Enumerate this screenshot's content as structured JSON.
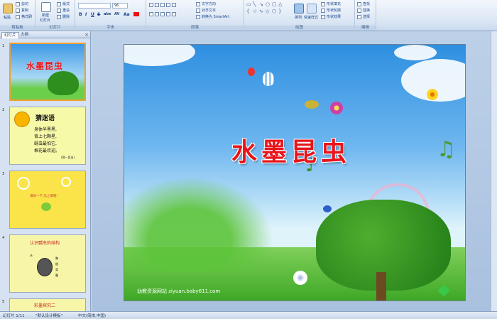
{
  "ribbon": {
    "clipboard": {
      "label": "剪贴板",
      "paste": "粘贴",
      "cut": "剪切",
      "copy": "复制",
      "format_painter": "格式刷"
    },
    "slides": {
      "label": "幻灯片",
      "new_slide": "新建",
      "new_slide_line2": "幻灯片",
      "layout": "版式",
      "reset": "重设",
      "delete": "删除"
    },
    "font": {
      "label": "字体",
      "size": "96",
      "bold": "B",
      "italic": "I",
      "underline": "U",
      "strike": "S",
      "shadow": "abe",
      "spacing": "AV",
      "case": "Aa"
    },
    "paragraph": {
      "label": "段落",
      "text_direction": "文字方向",
      "align_text": "对齐文本",
      "smartart": "转换为 SmartArt"
    },
    "drawing": {
      "label": "绘图",
      "arrange": "排列",
      "quick_styles": "快速样式",
      "fill": "形状填充",
      "outline": "形状轮廓",
      "effects": "形状效果"
    },
    "editing": {
      "label": "编辑",
      "find": "查找",
      "replace": "替换",
      "select": "选择"
    }
  },
  "pane": {
    "tab_slides": "幻灯片",
    "tab_outline": "大纲",
    "close": "×",
    "thumbnails": [
      {
        "num": "1",
        "title": "水墨昆虫"
      },
      {
        "num": "2",
        "title": "猜迷语",
        "lines": [
          "身体半黑黑,",
          "背上七颗星,",
          "蚜虫最怕它,",
          "棉花最欢迎。"
        ],
        "answer": "(猜一昆虫)"
      },
      {
        "num": "3",
        "text": "请你一下,马上揭晓!"
      },
      {
        "num": "4",
        "title": "认识瓢虫的结构",
        "labels": [
          "头",
          "胸",
          "翅",
          "背",
          "腹"
        ]
      },
      {
        "num": "5",
        "title": "彩墨探究二"
      }
    ]
  },
  "slide": {
    "title": "水墨昆虫",
    "site": "幼教资源网站  ziyuan.baby611.com"
  },
  "status": {
    "slide_count": "幻灯片 1/11",
    "theme": "\"默认设计模板\"",
    "language": "中文(简体,中国)"
  }
}
